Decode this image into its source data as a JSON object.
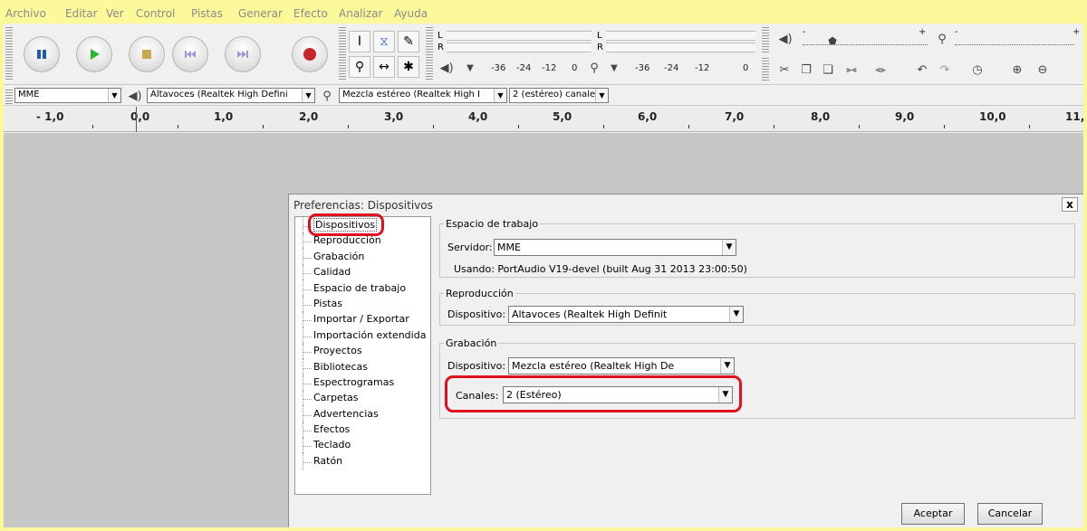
{
  "menu": [
    "Archivo",
    "Editar",
    "Ver",
    "Control",
    "Pistas",
    "Generar",
    "Efecto",
    "Analizar",
    "Ayuda"
  ],
  "meters": {
    "playback_left": "L",
    "playback_right": "R",
    "record_left": "L",
    "record_right": "R",
    "scale_play": [
      "-36",
      "-24",
      "-12",
      "0"
    ],
    "scale_rec": [
      "-36",
      "-24",
      "-12",
      "0"
    ],
    "mixer_minus": "-",
    "mixer_plus": "+",
    "mixer_minus2": "-",
    "mixer_plus2": "+"
  },
  "device_toolbar": {
    "host": "MME",
    "output": "Altavoces (Realtek High Defini",
    "input": "Mezcla estéreo (Realtek High I",
    "channels": "2 (estéreo) canale"
  },
  "ruler": {
    "labels": [
      "- 1,0",
      "0,0",
      "1,0",
      "2,0",
      "3,0",
      "4,0",
      "5,0",
      "6,0",
      "7,0",
      "8,0",
      "9,0",
      "10,0",
      "11,"
    ]
  },
  "dialog": {
    "title": "Preferencias: Dispositivos",
    "close": "x",
    "tree": [
      "Dispositivos",
      "Reproducción",
      "Grabación",
      "Calidad",
      "Espacio de trabajo",
      "Pistas",
      "Importar / Exportar",
      "Importación extendida",
      "Proyectos",
      "Bibliotecas",
      "Espectrogramas",
      "Carpetas",
      "Advertencias",
      "Efectos",
      "Teclado",
      "Ratón"
    ],
    "workspace": {
      "legend": "Espacio de trabajo",
      "server_label": "Servidor:",
      "server_value": "MME",
      "using_text": "Usando: PortAudio V19-devel (built Aug 31 2013 23:00:50)"
    },
    "playback": {
      "legend": "Reproducción",
      "device_label": "Dispositivo:",
      "device_value": "Altavoces (Realtek High Definit"
    },
    "recording": {
      "legend": "Grabación",
      "device_label": "Dispositivo:",
      "device_value": "Mezcla estéreo (Realtek High De",
      "channels_label": "Canales:",
      "channels_value": "2 (Estéreo)"
    },
    "ok": "Aceptar",
    "cancel": "Cancelar"
  },
  "colors": {
    "highlight": "#e0101c",
    "page_border": "#fcf99a",
    "play_green": "#2fb52f",
    "pause_blue": "#2058b8",
    "record_red": "#c8272a"
  }
}
